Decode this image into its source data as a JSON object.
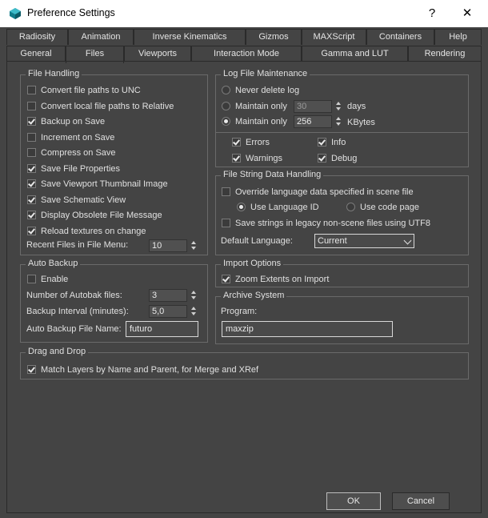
{
  "window": {
    "title": "Preference Settings",
    "help_glyph": "?",
    "close_glyph": "✕"
  },
  "tabs_row1": [
    "Radiosity",
    "Animation",
    "Inverse Kinematics",
    "Gizmos",
    "MAXScript",
    "Containers",
    "Help"
  ],
  "tabs_row2": [
    "General",
    "Files",
    "Viewports",
    "Interaction Mode",
    "Gamma and LUT",
    "Rendering"
  ],
  "active_tab": "Files",
  "file_handling": {
    "title": "File Handling",
    "options": [
      {
        "label": "Convert file paths to UNC",
        "checked": false
      },
      {
        "label": "Convert local file paths to Relative",
        "checked": false
      },
      {
        "label": "Backup on Save",
        "checked": true
      },
      {
        "label": "Increment on Save",
        "checked": false
      },
      {
        "label": "Compress on Save",
        "checked": false
      },
      {
        "label": "Save File Properties",
        "checked": true
      },
      {
        "label": "Save Viewport Thumbnail Image",
        "checked": true
      },
      {
        "label": "Save Schematic View",
        "checked": true
      },
      {
        "label": "Display Obsolete File Message",
        "checked": true
      },
      {
        "label": "Reload textures on change",
        "checked": true
      }
    ],
    "recent_label": "Recent Files in File Menu:",
    "recent_value": "10"
  },
  "auto_backup": {
    "title": "Auto Backup",
    "enable_label": "Enable",
    "enable_checked": false,
    "num_label": "Number of Autobak files:",
    "num_value": "3",
    "interval_label": "Backup Interval (minutes):",
    "interval_value": "5,0",
    "name_label": "Auto Backup File Name:",
    "name_value": "futuro"
  },
  "log_file": {
    "title": "Log File Maintenance",
    "never_label": "Never delete log",
    "never_selected": false,
    "days_label": "Maintain only",
    "days_value": "30",
    "days_unit": "days",
    "days_selected": false,
    "kb_label": "Maintain only",
    "kb_value": "256",
    "kb_unit": "KBytes",
    "kb_selected": true,
    "levels": [
      {
        "label": "Errors",
        "checked": true
      },
      {
        "label": "Info",
        "checked": true
      },
      {
        "label": "Warnings",
        "checked": true
      },
      {
        "label": "Debug",
        "checked": true
      }
    ]
  },
  "file_string": {
    "title": "File String Data Handling",
    "override_label": "Override language data specified in scene file",
    "override_checked": false,
    "lang_id_label": "Use Language ID",
    "lang_id_selected": true,
    "code_page_label": "Use code page",
    "code_page_selected": false,
    "utf8_label": "Save strings in legacy non-scene files using UTF8",
    "utf8_checked": false,
    "default_lang_label": "Default Language:",
    "default_lang_value": "Current"
  },
  "import_options": {
    "title": "Import Options",
    "zoom_label": "Zoom Extents on Import",
    "zoom_checked": true
  },
  "archive": {
    "title": "Archive System",
    "program_label": "Program:",
    "program_value": "maxzip"
  },
  "drag_drop": {
    "title": "Drag and Drop",
    "match_label": "Match Layers by Name and Parent, for Merge and XRef",
    "match_checked": true
  },
  "footer": {
    "ok_label": "OK",
    "cancel_label": "Cancel"
  }
}
